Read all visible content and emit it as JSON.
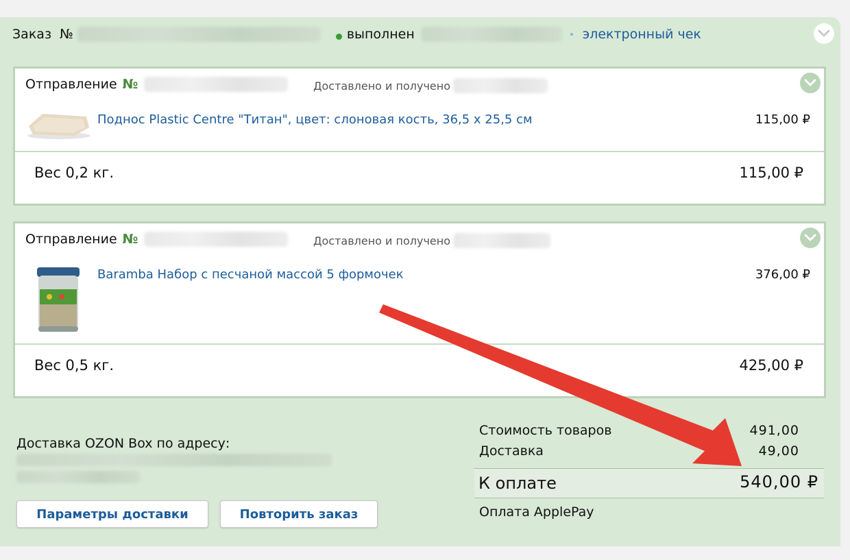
{
  "order": {
    "label": "Заказ",
    "number_sign": "№",
    "status": "выполнен",
    "receipt_link": "электронный чек"
  },
  "shipments": [
    {
      "label": "Отправление",
      "number_sign": "№",
      "status": "Доставлено и получено",
      "item_name": "Поднос Plastic Centre \"Титан\", цвет: слоновая кость, 36,5 x 25,5 см",
      "item_price": "115,00 ₽",
      "weight": "Вес 0,2 кг.",
      "total": "115,00 ₽"
    },
    {
      "label": "Отправление",
      "number_sign": "№",
      "status": "Доставлено и получено",
      "item_name": "Baramba Набор с песчаной массой 5 формочек",
      "item_price": "376,00 ₽",
      "weight": "Вес 0,5 кг.",
      "total": "425,00 ₽"
    }
  ],
  "delivery": {
    "label": "Доставка OZON Box по адресу:",
    "params_button": "Параметры доставки",
    "repeat_button": "Повторить заказ"
  },
  "summary": {
    "goods_label": "Стоимость товаров",
    "goods_value": "491,00",
    "delivery_label": "Доставка",
    "delivery_value": "49,00",
    "topay_label": "К оплате",
    "topay_value": "540,00 ₽",
    "payment": "Оплата ApplePay"
  },
  "colors": {
    "panel_bg": "#d8e9d6",
    "link": "#1d5d9b",
    "accent_green": "#4b8a3f",
    "arrow": "#e53a2f"
  }
}
